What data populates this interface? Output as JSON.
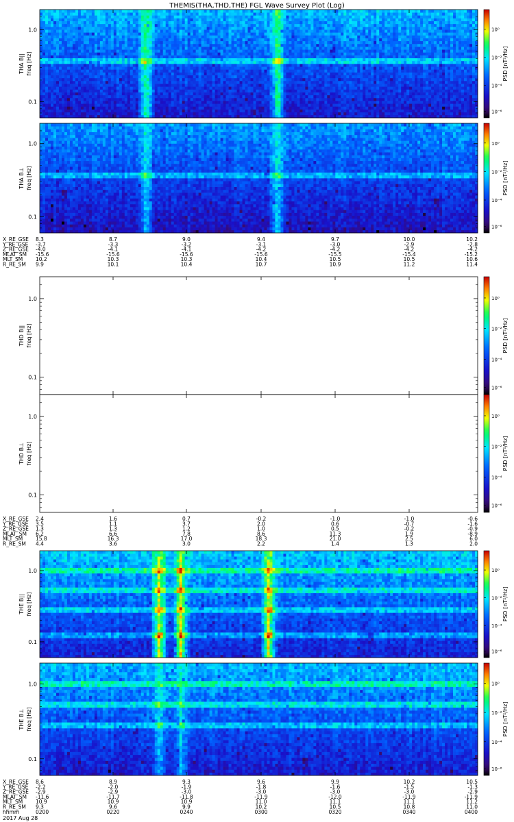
{
  "title": "THEMIS(THA,THD,THE) FGL Wave Survey Plot (Log)",
  "date_label": "2017 Aug 28",
  "chart_data": [
    {
      "type": "heatmap",
      "probe": "THA",
      "component": "B||",
      "ylabel": "THA B||",
      "yunit": "freq [Hz]",
      "cbar_label": "PSD [nT²/Hz]",
      "yscale": "log",
      "ylim": [
        0.06,
        1.9
      ],
      "yticks": [
        "1.0",
        "0.1"
      ],
      "ctick_labels": [
        "10⁰",
        "10⁻²",
        "10⁻⁴",
        "10⁻⁶"
      ],
      "has_data": true,
      "bands": [
        0.36
      ],
      "bursts": [
        0.24,
        0.54
      ],
      "burst_strength": 0.45,
      "base_level": 0.18
    },
    {
      "type": "heatmap",
      "probe": "THA",
      "component": "B⊥",
      "ylabel": "THA B⊥",
      "yunit": "freq [Hz]",
      "cbar_label": "PSD [nT²/Hz]",
      "yscale": "log",
      "ylim": [
        0.06,
        1.9
      ],
      "yticks": [
        "1.0",
        "0.1"
      ],
      "ctick_labels": [
        "10⁰",
        "10⁻²",
        "10⁻⁴",
        "10⁻⁶"
      ],
      "has_data": true,
      "bands": [
        0.36
      ],
      "bursts": [
        0.24,
        0.54
      ],
      "burst_strength": 0.35,
      "base_level": 0.14
    },
    {
      "type": "heatmap",
      "probe": "THD",
      "component": "B||",
      "ylabel": "THD B||",
      "yunit": "freq [Hz]",
      "cbar_label": "PSD [nT²/Hz]",
      "yscale": "log",
      "ylim": [
        0.06,
        1.9
      ],
      "yticks": [
        "1.0",
        "0.1"
      ],
      "ctick_labels": [
        "10⁰",
        "10⁻²",
        "10⁻⁴",
        "10⁻⁶"
      ],
      "has_data": false
    },
    {
      "type": "heatmap",
      "probe": "THD",
      "component": "B⊥",
      "ylabel": "THD B⊥",
      "yunit": "freq [Hz]",
      "cbar_label": "PSD [nT²/Hz]",
      "yscale": "log",
      "ylim": [
        0.06,
        1.9
      ],
      "yticks": [
        "1.0",
        "0.1"
      ],
      "ctick_labels": [
        "10⁰",
        "10⁻²",
        "10⁻⁴",
        "10⁻⁶"
      ],
      "has_data": false
    },
    {
      "type": "heatmap",
      "probe": "THE",
      "component": "B||",
      "ylabel": "THE B||",
      "yunit": "freq [Hz]",
      "cbar_label": "PSD [nT²/Hz]",
      "yscale": "log",
      "ylim": [
        0.06,
        1.9
      ],
      "yticks": [
        "1.0",
        "0.1"
      ],
      "ctick_labels": [
        "10⁰",
        "10⁻²",
        "10⁻⁴",
        "10⁻⁶"
      ],
      "has_data": true,
      "bands": [
        0.95,
        0.5,
        0.26,
        0.12
      ],
      "bursts": [
        0.27,
        0.32,
        0.52
      ],
      "burst_strength": 0.6,
      "base_level": 0.2
    },
    {
      "type": "heatmap",
      "probe": "THE",
      "component": "B⊥",
      "ylabel": "THE B⊥",
      "yunit": "freq [Hz]",
      "cbar_label": "PSD [nT²/Hz]",
      "yscale": "log",
      "ylim": [
        0.06,
        1.9
      ],
      "yticks": [
        "1.0",
        "0.1"
      ],
      "ctick_labels": [
        "10⁰",
        "10⁻²",
        "10⁻⁴",
        "10⁻⁶"
      ],
      "has_data": true,
      "bands": [
        0.95,
        0.5,
        0.26
      ],
      "bursts": [
        0.27,
        0.32
      ],
      "burst_strength": 0.25,
      "base_level": 0.18
    }
  ],
  "ephemeris": [
    {
      "probe": "THA",
      "rows": [
        {
          "label": "X_RE_GSE",
          "values": [
            "8.3",
            "8.7",
            "9.0",
            "9.4",
            "9.7",
            "10.0",
            "10.2"
          ]
        },
        {
          "label": "Y_RE_GSE",
          "values": [
            "-3.7",
            "-3.3",
            "-3.2",
            "-3.1",
            "-3.0",
            "-2.9",
            "-2.8"
          ]
        },
        {
          "label": "Z_RE_GSE",
          "values": [
            "-4.0",
            "-4.1",
            "-4.1",
            "-4.2",
            "-4.2",
            "-4.2",
            "-4.2"
          ]
        },
        {
          "label": "MLAT_SM",
          "values": [
            "-15.6",
            "-15.6",
            "-15.6",
            "-15.6",
            "-15.5",
            "-15.4",
            "-15.2"
          ]
        },
        {
          "label": "MLT_SM",
          "values": [
            "10.2",
            "10.3",
            "10.3",
            "10.4",
            "10.5",
            "10.5",
            "10.6"
          ]
        },
        {
          "label": "R_RE_SM",
          "values": [
            "9.9",
            "10.1",
            "10.4",
            "10.7",
            "10.9",
            "11.2",
            "11.4"
          ]
        }
      ]
    },
    {
      "probe": "THD",
      "rows": [
        {
          "label": "X_RE_GSE",
          "values": [
            "2.4",
            "1.6",
            "0.7",
            "-0.2",
            "-1.0",
            "-1.0",
            "-0.6"
          ]
        },
        {
          "label": "Y_RE_GSE",
          "values": [
            "3.5",
            "1.1",
            "3.7",
            "2.0",
            "0.6",
            "-0.7",
            "-1.6"
          ]
        },
        {
          "label": "Z_RE_GSE",
          "values": [
            "1.3",
            "1.3",
            "1.2",
            "1.0",
            "0.5",
            "-0.2",
            "-0.9"
          ]
        },
        {
          "label": "MLAT_SM",
          "values": [
            "6.2",
            "6.6",
            "7.8",
            "8.6",
            "11.3",
            "1.9",
            "-8.9"
          ]
        },
        {
          "label": "MLT_SM",
          "values": [
            "15.8",
            "16.3",
            "17.0",
            "18.3",
            "21.0",
            "2.5",
            "6.0"
          ]
        },
        {
          "label": "R_RE_SM",
          "values": [
            "4.4",
            "3.6",
            "3.0",
            "2.2",
            "1.4",
            "1.3",
            "2.0"
          ]
        }
      ]
    },
    {
      "probe": "THE",
      "rows": [
        {
          "label": "X_RE_GSE",
          "values": [
            "8.6",
            "8.9",
            "9.3",
            "9.6",
            "9.9",
            "10.2",
            "10.5"
          ]
        },
        {
          "label": "Y_RE_GSE",
          "values": [
            "-2.2",
            "-2.0",
            "-1.9",
            "-1.8",
            "-1.6",
            "-1.5",
            "-1.3"
          ]
        },
        {
          "label": "Z_RE_GSE",
          "values": [
            "-2.9",
            "-2.9",
            "-3.0",
            "-3.0",
            "-3.0",
            "-3.0",
            "-2.9"
          ]
        },
        {
          "label": "MLAT_SM",
          "values": [
            "-11.6",
            "-11.7",
            "-11.8",
            "-11.9",
            "-12.0",
            "-11.9",
            "-11.9"
          ]
        },
        {
          "label": "MLT_SM",
          "values": [
            "10.9",
            "10.9",
            "10.9",
            "11.0",
            "11.1",
            "11.1",
            "11.2"
          ]
        },
        {
          "label": "R_RE_SM",
          "values": [
            "9.3",
            "9.6",
            "9.9",
            "10.2",
            "10.5",
            "10.8",
            "11.0"
          ]
        },
        {
          "label": "hhmm",
          "values": [
            "0200",
            "0220",
            "0240",
            "0300",
            "0320",
            "0340",
            "0400"
          ]
        }
      ]
    }
  ]
}
